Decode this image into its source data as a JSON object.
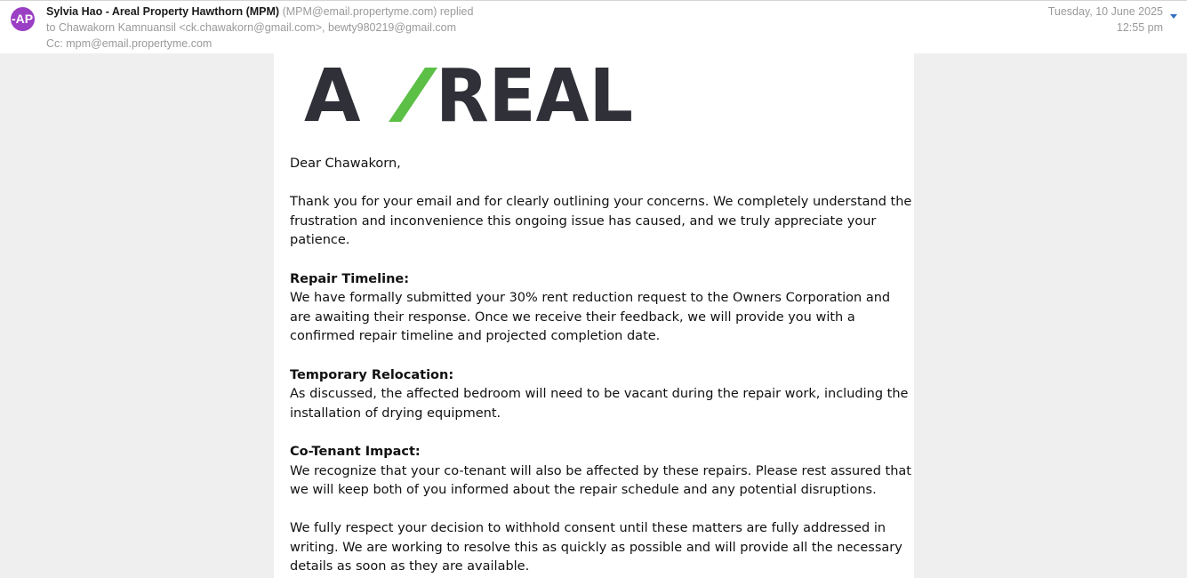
{
  "header": {
    "avatar_initials": "-AP",
    "sender_name": "Sylvia Hao - Areal Property Hawthorn (MPM)",
    "sender_email": "(MPM@email.propertyme.com)",
    "action": "replied",
    "to_line": "to Chawakorn Kamnuansil <ck.chawakorn@gmail.com>, bewty980219@gmail.com",
    "cc_line": "Cc: mpm@email.propertyme.com",
    "date": "Tuesday, 10 June 2025",
    "time": "12:55 pm",
    "expand_icon": "chevron-down-icon",
    "avatar_color": "#9b3fc4",
    "accent_color": "#2f6fc1"
  },
  "logo": {
    "text_left": "A",
    "text_right": "REAL",
    "letter_color": "#2f3038",
    "slash_color": "#5cbf46"
  },
  "body": {
    "greeting": "Dear Chawakorn,",
    "intro": "Thank you for your email and for clearly outlining your concerns. We completely understand the frustration and inconvenience this ongoing issue has caused, and we truly appreciate your patience.",
    "sections": [
      {
        "heading": "Repair Timeline:",
        "text": "We have formally submitted your 30% rent reduction request to the Owners Corporation and are awaiting their response. Once we receive their feedback, we will provide you with a confirmed repair timeline and projected completion date."
      },
      {
        "heading": "Temporary Relocation:",
        "text": "As discussed, the affected bedroom will need to be vacant during the repair work, including the installation of drying equipment."
      },
      {
        "heading": "Co-Tenant Impact:",
        "text": "We recognize that your co-tenant will also be affected by these repairs. Please rest assured that we will keep both of you informed about the repair schedule and any potential disruptions."
      }
    ],
    "closing": "We fully respect your decision to withhold consent until these matters are fully addressed in writing. We are working to resolve this as quickly as possible and will provide all the necessary details as soon as they are available."
  }
}
